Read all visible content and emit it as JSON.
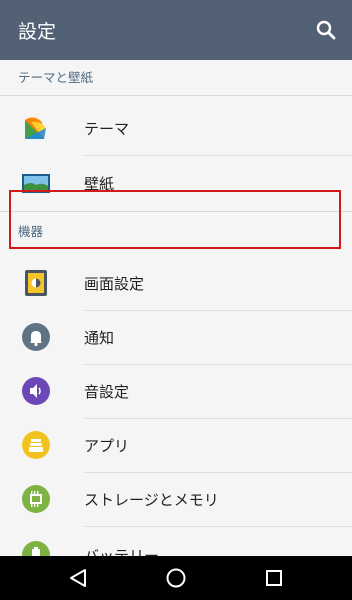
{
  "appbar": {
    "title": "設定",
    "search_icon": "search-icon"
  },
  "sections": [
    {
      "header": "テーマと壁紙"
    },
    {
      "header": "機器"
    }
  ],
  "items": [
    {
      "label": "テーマ",
      "icon": "theme-icon"
    },
    {
      "label": "壁紙",
      "icon": "wallpaper-icon"
    },
    {
      "label": "画面設定",
      "icon": "display-icon"
    },
    {
      "label": "通知",
      "icon": "bell-icon"
    },
    {
      "label": "音設定",
      "icon": "speaker-icon"
    },
    {
      "label": "アプリ",
      "icon": "apps-icon"
    },
    {
      "label": "ストレージとメモリ",
      "icon": "storage-icon"
    },
    {
      "label": "バッテリー",
      "icon": "battery-icon"
    }
  ],
  "navbar": {
    "back": "back-icon",
    "home": "home-icon",
    "recents": "recents-icon"
  },
  "colors": {
    "appbar": "#526173",
    "highlight": "#d21a1a",
    "section_text": "#4d6a83"
  }
}
